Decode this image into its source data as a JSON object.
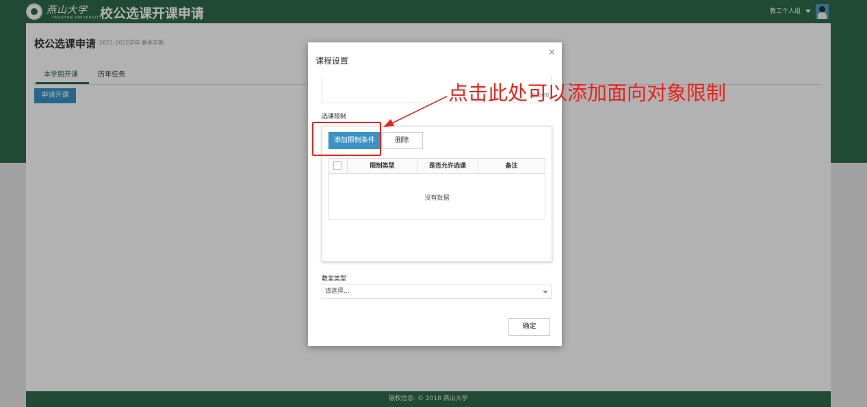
{
  "header": {
    "logo_script": "燕山大学",
    "logo_sub": "YANSHAN UNIVERSITY",
    "title": "校公选课开课申请",
    "user_group": "教工个人组"
  },
  "page": {
    "title": "校公选课申请",
    "semester": "2021-2022学年 春季学期",
    "tabs": [
      {
        "label": "本学期开课",
        "active": true
      },
      {
        "label": "历年任务",
        "active": false
      }
    ],
    "apply_button": "申请开课"
  },
  "modal": {
    "title": "课程设置",
    "close_symbol": "×",
    "char_counter": "0/600",
    "restriction_label": "选课限制",
    "add_button": "添加限制条件",
    "delete_button": "删除",
    "table": {
      "columns": [
        "限制类型",
        "是否允许选课",
        "备注"
      ],
      "empty_text": "没有数据"
    },
    "room_label": "教室类型",
    "room_placeholder": "请选择...",
    "confirm_button": "确定"
  },
  "annotation": {
    "text": "点击此处可以添加面向对象限制",
    "color": "#e8231c"
  },
  "footer": {
    "copyright": "版权信息: © 2018 燕山大学"
  },
  "colors": {
    "brand_green": "#2e6b4a",
    "button_blue": "#3a93c4"
  }
}
